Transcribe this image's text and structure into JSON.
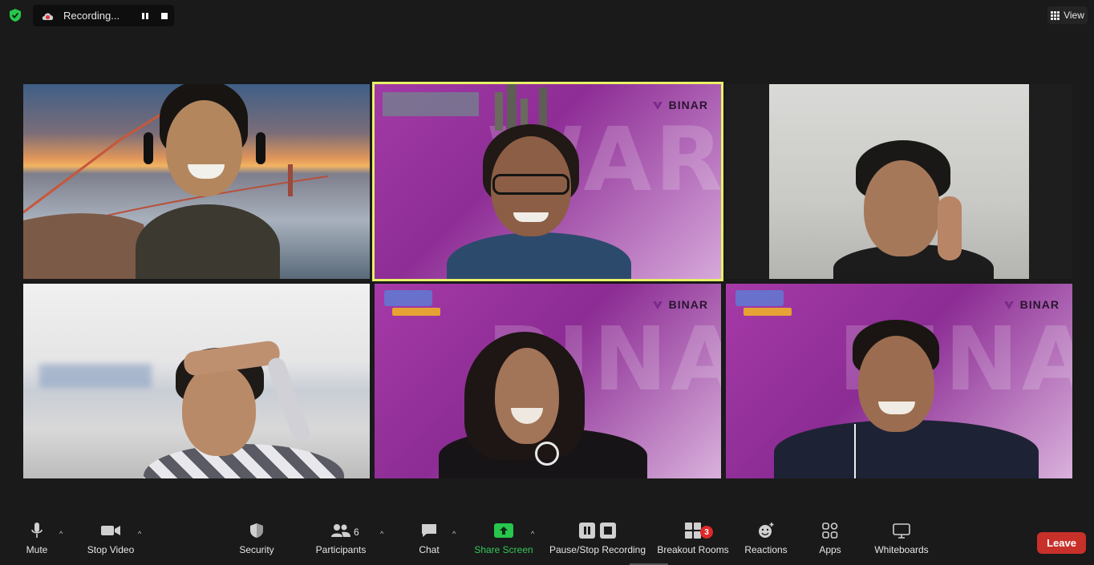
{
  "top_bar": {
    "recording_label": "Recording...",
    "view_label": "View",
    "icons": [
      "shield-check-icon",
      "cloud-record-icon",
      "pause-icon",
      "stop-icon",
      "grid-view-icon"
    ],
    "shield_color": "#27c64c"
  },
  "tiles": [
    {
      "background": "golden-gate-sunset"
    },
    {
      "background": "binar-purple",
      "logo": "BINAR",
      "active_speaker": true,
      "active_color": "#e8f068"
    },
    {
      "background": "plain-wall"
    },
    {
      "background": "blurred-room"
    },
    {
      "background": "binar-purple",
      "logo": "BINAR"
    },
    {
      "background": "binar-purple",
      "logo": "BINAR"
    }
  ],
  "toolbar": {
    "mute": "Mute",
    "stop_video": "Stop Video",
    "security": "Security",
    "participants": "Participants",
    "participants_count": "6",
    "chat": "Chat",
    "share_screen": "Share Screen",
    "pause_stop_recording": "Pause/Stop Recording",
    "breakout_rooms": "Breakout Rooms",
    "breakout_badge": "3",
    "reactions": "Reactions",
    "apps": "Apps",
    "whiteboards": "Whiteboards",
    "leave": "Leave"
  },
  "colors": {
    "background": "#1a1a1a",
    "share_green": "#27c64c",
    "leave_red": "#c8302a",
    "binar_purple": "#8e2d96"
  }
}
